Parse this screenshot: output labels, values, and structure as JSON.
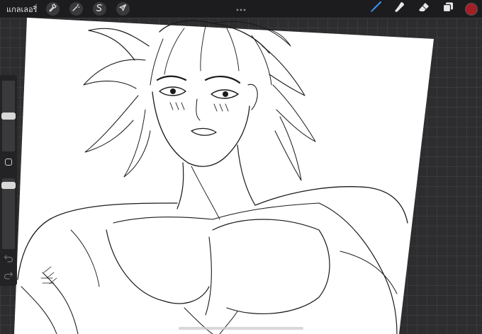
{
  "topbar": {
    "gallery_label": "แกลเลอรี่",
    "tools_left": [
      {
        "name": "actions",
        "icon": "wrench-icon"
      },
      {
        "name": "adjustments",
        "icon": "magic-wand-icon"
      },
      {
        "name": "selection",
        "icon": "selection-s-icon"
      },
      {
        "name": "transform",
        "icon": "arrow-cursor-icon"
      }
    ],
    "tools_right": [
      {
        "name": "brush",
        "icon": "brush-icon",
        "active": true
      },
      {
        "name": "smudge",
        "icon": "smudge-icon"
      },
      {
        "name": "eraser",
        "icon": "eraser-icon"
      },
      {
        "name": "layers",
        "icon": "layers-icon"
      }
    ],
    "current_color": "#a41f25",
    "active_tool_color": "#3b8ef0"
  },
  "sidebar": {
    "brush_size_level": 0.5,
    "opacity_level": 0.95
  },
  "canvas": {
    "paper_color": "#ffffff",
    "workspace_color": "#2d2d2f"
  }
}
